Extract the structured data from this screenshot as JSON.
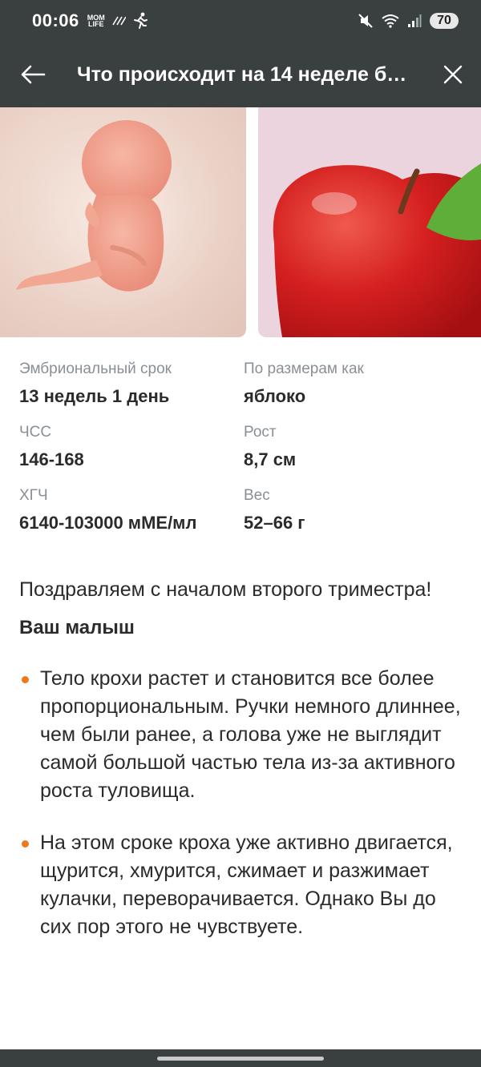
{
  "status_bar": {
    "time": "00:06",
    "app_badge": "MOM LIFE",
    "battery": "70"
  },
  "app_bar": {
    "title": "Что происходит на 14 неделе бе…",
    "back_icon": "arrow-left-icon",
    "close_icon": "close-icon"
  },
  "images": {
    "left": "fetus-image",
    "right": "apple-image"
  },
  "facts": [
    [
      {
        "label": "Эмбриональный срок",
        "value": "13 недель 1 день"
      },
      {
        "label": "По размерам как",
        "value": "яблоко"
      }
    ],
    [
      {
        "label": "ЧСС",
        "value": "146-168"
      },
      {
        "label": "Рост",
        "value": "8,7 см"
      }
    ],
    [
      {
        "label": "ХГЧ",
        "value": "6140-103000 мМЕ/мл"
      },
      {
        "label": "Вес",
        "value": "52–66 г"
      }
    ]
  ],
  "article": {
    "intro": "Поздравляем с началом второго триместра!",
    "subhead": "Ваш малыш",
    "bullets": [
      "Тело крохи растет и становится все более пропорциональным. Ручки немного длиннее, чем были ранее, а голова уже не выглядит самой большой частью тела из-за активного роста туловища.",
      "На этом сроке кроха уже активно двигается, щурится, хмурится, сжимает и разжимает кулачки, переворачивается. Однако Вы до сих пор этого не чувствуете."
    ]
  },
  "colors": {
    "bar_background": "#39403f",
    "bullet_accent": "#ec7a1d",
    "label_gray": "#8a8f95"
  }
}
